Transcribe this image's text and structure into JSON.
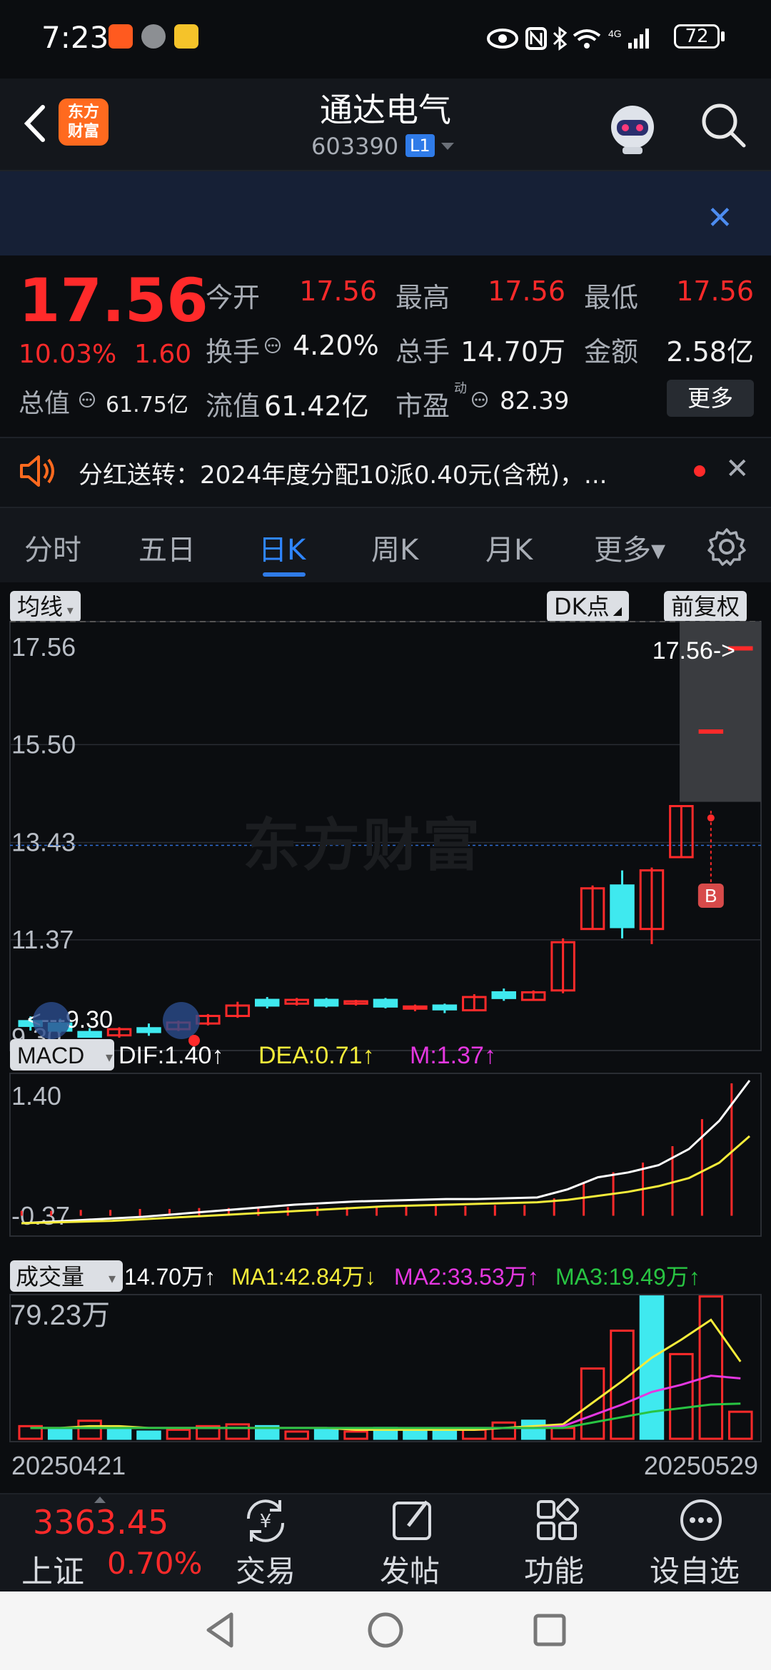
{
  "status_bar": {
    "time": "7:23",
    "battery": "72",
    "network": "4G"
  },
  "header": {
    "back_icon": "chevron-left-icon",
    "logo_text_1": "东方",
    "logo_text_2": "财富",
    "title": "通达电气",
    "code": "603390",
    "level": "L1"
  },
  "quote": {
    "price": "17.56",
    "change_pct": "10.03%",
    "change": "1.60",
    "market_cap_label": "总值",
    "market_cap": "61.75亿",
    "open_label": "今开",
    "open": "17.56",
    "high_label": "最高",
    "high": "17.56",
    "low_label": "最低",
    "low": "17.56",
    "turnover_label": "换手",
    "turnover": "4.20%",
    "volume_label": "总手",
    "volume": "14.70万",
    "amount_label": "金额",
    "amount": "2.58亿",
    "float_cap_label": "流值",
    "float_cap": "61.42亿",
    "pe_label": "市盈",
    "pe_sup": "动",
    "pe": "82.39",
    "more_label": "更多"
  },
  "dividend": {
    "text": "分红送转：2024年度分配10派0.40元(含税)，..."
  },
  "tabs": [
    {
      "label": "分时"
    },
    {
      "label": "五日"
    },
    {
      "label": "日K"
    },
    {
      "label": "周K"
    },
    {
      "label": "月K"
    },
    {
      "label": "更多▾"
    }
  ],
  "chart_controls": {
    "ma_label": "均线",
    "dk_label": "DK点",
    "adjust_label": "前复权"
  },
  "watermark": "东方财富",
  "chart_data": [
    {
      "type": "candlestick",
      "title": "",
      "y_ticks": [
        "17.56",
        "15.50",
        "13.43",
        "11.37",
        "9.30"
      ],
      "ylim": [
        9.3,
        17.56
      ],
      "current_price_label": "17.56->",
      "low_marker_label": "<---9.30",
      "signal_label": "B",
      "x_start": "20250421",
      "x_end": "20250529",
      "candles": [
        {
          "o": 9.65,
          "c": 9.55,
          "h": 9.75,
          "l": 9.45
        },
        {
          "o": 9.6,
          "c": 9.45,
          "h": 9.7,
          "l": 9.4
        },
        {
          "o": 9.42,
          "c": 9.32,
          "h": 9.5,
          "l": 9.3
        },
        {
          "o": 9.35,
          "c": 9.48,
          "h": 9.52,
          "l": 9.3
        },
        {
          "o": 9.5,
          "c": 9.42,
          "h": 9.6,
          "l": 9.34
        },
        {
          "o": 9.48,
          "c": 9.62,
          "h": 9.66,
          "l": 9.44
        },
        {
          "o": 9.6,
          "c": 9.76,
          "h": 9.8,
          "l": 9.56
        },
        {
          "o": 9.76,
          "c": 9.98,
          "h": 10.06,
          "l": 9.72
        },
        {
          "o": 10.1,
          "c": 9.98,
          "h": 10.16,
          "l": 9.92
        },
        {
          "o": 10.02,
          "c": 10.1,
          "h": 10.14,
          "l": 9.98
        },
        {
          "o": 10.1,
          "c": 9.98,
          "h": 10.14,
          "l": 9.94
        },
        {
          "o": 10.02,
          "c": 10.07,
          "h": 10.1,
          "l": 9.98
        },
        {
          "o": 10.1,
          "c": 9.96,
          "h": 10.14,
          "l": 9.92
        },
        {
          "o": 9.92,
          "c": 9.96,
          "h": 10.0,
          "l": 9.86
        },
        {
          "o": 9.98,
          "c": 9.9,
          "h": 10.02,
          "l": 9.82
        },
        {
          "o": 9.88,
          "c": 10.16,
          "h": 10.22,
          "l": 9.86
        },
        {
          "o": 10.26,
          "c": 10.14,
          "h": 10.34,
          "l": 10.08
        },
        {
          "o": 10.1,
          "c": 10.26,
          "h": 10.3,
          "l": 10.08
        },
        {
          "o": 10.3,
          "c": 11.32,
          "h": 11.4,
          "l": 10.24
        },
        {
          "o": 11.6,
          "c": 12.46,
          "h": 12.52,
          "l": 11.58
        },
        {
          "o": 12.52,
          "c": 11.64,
          "h": 12.84,
          "l": 11.4
        },
        {
          "o": 11.6,
          "c": 12.84,
          "h": 12.9,
          "l": 11.28
        },
        {
          "o": 13.12,
          "c": 14.2,
          "h": 14.22,
          "l": 13.1
        },
        {
          "o": 15.8,
          "c": 15.8,
          "h": 15.8,
          "l": 15.8
        },
        {
          "o": 17.56,
          "c": 17.56,
          "h": 17.56,
          "l": 17.56
        }
      ]
    },
    {
      "type": "line",
      "title": "MACD",
      "label": "MACD",
      "dif_label": "DIF:1.40↑",
      "dea_label": "DEA:0.71↑",
      "m_label": "M:1.37↑",
      "y_ticks": [
        "1.40",
        "-0.37"
      ],
      "ylim": [
        -0.37,
        1.4
      ],
      "series": [
        {
          "name": "DIF",
          "color": "#ffffff",
          "values": [
            -0.37,
            -0.35,
            -0.33,
            -0.31,
            -0.29,
            -0.26,
            -0.23,
            -0.2,
            -0.17,
            -0.14,
            -0.12,
            -0.1,
            -0.09,
            -0.08,
            -0.07,
            -0.07,
            -0.06,
            -0.05,
            0.05,
            0.2,
            0.26,
            0.35,
            0.55,
            0.9,
            1.4
          ]
        },
        {
          "name": "DEA",
          "color": "#f5ec3a",
          "values": [
            -0.37,
            -0.36,
            -0.35,
            -0.34,
            -0.32,
            -0.3,
            -0.28,
            -0.26,
            -0.24,
            -0.22,
            -0.2,
            -0.18,
            -0.16,
            -0.15,
            -0.14,
            -0.13,
            -0.12,
            -0.11,
            -0.08,
            -0.03,
            0.02,
            0.09,
            0.19,
            0.38,
            0.71
          ]
        }
      ],
      "bars": [
        0.05,
        0.05,
        0.06,
        0.06,
        0.07,
        0.07,
        0.08,
        0.08,
        0.08,
        0.09,
        0.09,
        0.09,
        0.09,
        0.1,
        0.1,
        0.1,
        0.11,
        0.11,
        0.18,
        0.35,
        0.45,
        0.55,
        0.72,
        1.0,
        1.37
      ]
    },
    {
      "type": "bar",
      "title": "成交量",
      "label": "成交量",
      "vol_label": "14.70万↑",
      "ma1_label": "MA1:42.84万↓",
      "ma2_label": "MA2:33.53万↑",
      "ma3_label": "MA3:19.49万↑",
      "y_tick": "79.23万",
      "ylim": [
        0,
        79.23
      ],
      "unit": "万",
      "values": [
        7,
        5,
        10,
        6,
        4,
        5,
        7,
        8,
        7,
        4,
        5,
        4,
        6,
        4,
        4,
        5,
        9,
        10,
        6,
        39,
        60,
        79,
        47,
        79,
        15
      ],
      "bar_up": [
        true,
        false,
        true,
        false,
        false,
        true,
        true,
        true,
        false,
        true,
        false,
        true,
        false,
        false,
        false,
        true,
        true,
        false,
        true,
        true,
        true,
        false,
        true,
        true,
        true
      ],
      "ma1": [
        6,
        6,
        7,
        7,
        6,
        6,
        6,
        6,
        6,
        6,
        6,
        5,
        5,
        5,
        5,
        5,
        6,
        7,
        8,
        20,
        32,
        45,
        55,
        66,
        42.84
      ],
      "ma2": [
        6,
        6,
        6,
        6,
        6,
        6,
        6,
        6,
        6,
        6,
        6,
        6,
        6,
        6,
        6,
        6,
        6,
        6,
        7,
        13,
        19,
        26,
        30,
        35,
        33.53
      ],
      "ma3": [
        6,
        6,
        6,
        6,
        6,
        6,
        6,
        6,
        6,
        6,
        6,
        6,
        6,
        6,
        6,
        6,
        6,
        6,
        6,
        9,
        12,
        15,
        17,
        19,
        19.49
      ]
    }
  ],
  "bottom_nav": {
    "index_value": "3363.45",
    "index_name": "上证",
    "index_change": "0.70%",
    "items": [
      {
        "label": "交易"
      },
      {
        "label": "发帖"
      },
      {
        "label": "功能"
      },
      {
        "label": "设自选"
      }
    ]
  }
}
